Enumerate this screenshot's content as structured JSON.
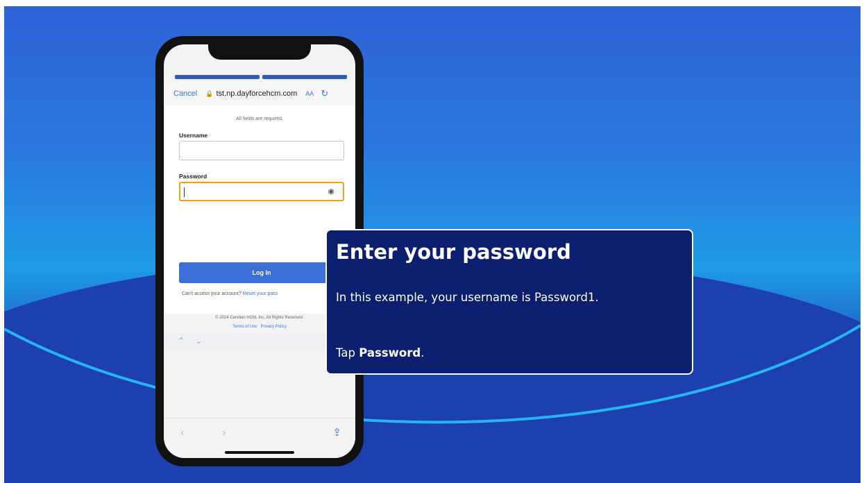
{
  "browser": {
    "cancel_label": "Cancel",
    "url": "tst.np.dayforcehcm.com",
    "text_size_label": "AA",
    "reload_icon": "reload-icon",
    "lock_icon": "lock-icon"
  },
  "form": {
    "required_note": "All fields are required.",
    "username_label": "Username",
    "username_value": "",
    "password_label": "Password",
    "password_value": "",
    "show_password_icon": "eye-icon",
    "login_button": "Log In",
    "cant_access_text": "Can't access your account?",
    "reset_link": "Reset your pass",
    "copyright": "© 2024 Ceridian HCM, Inc. All Rights Reserved.",
    "terms_link": "Terms of Use",
    "privacy_link": "Privacy Policy"
  },
  "callout": {
    "title": "Enter your password",
    "body_line": "In this example, your username is Password1.",
    "tap_prefix": "Tap ",
    "tap_target": "Password",
    "tap_suffix": "."
  },
  "colors": {
    "callout_bg": "#0c1f6e",
    "accent_blue": "#3d6fd9",
    "focus_outline": "#f0a020"
  }
}
